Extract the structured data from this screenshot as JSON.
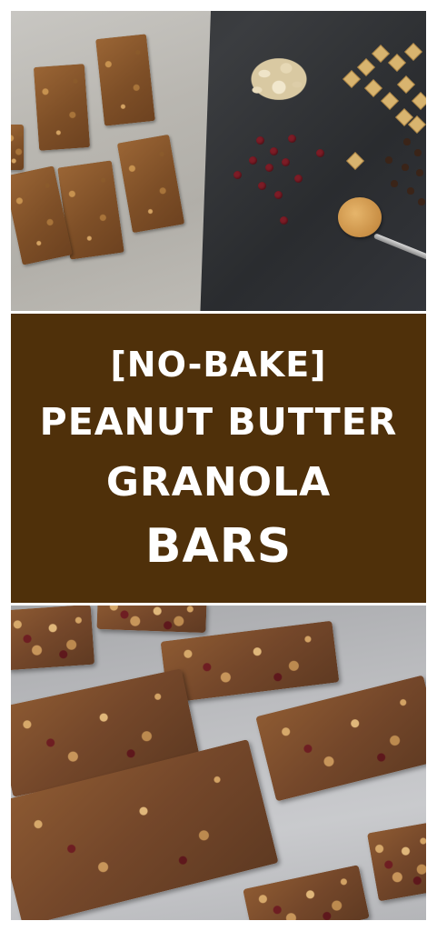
{
  "pin": {
    "title_lines": [
      "[NO-BAKE]",
      "PEANUT BUTTER",
      "GRANOLA",
      "BARS"
    ]
  },
  "colors": {
    "banner_bg": "#4f300a",
    "banner_text": "#ffffff",
    "frame_bg": "#ffffff"
  },
  "photos": {
    "top": "overhead photo of granola bars on parchment with oats, cereal squares, dried cranberries, chocolate chips and a spoon of peanut butter",
    "bottom": "close-up photo of granola bars on parchment paper"
  }
}
